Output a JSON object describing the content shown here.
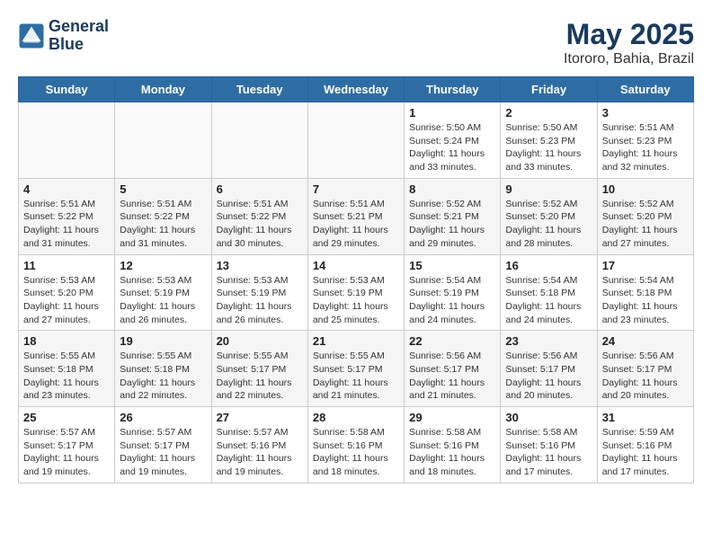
{
  "header": {
    "logo_line1": "General",
    "logo_line2": "Blue",
    "title": "May 2025",
    "subtitle": "Itororo, Bahia, Brazil"
  },
  "days_of_week": [
    "Sunday",
    "Monday",
    "Tuesday",
    "Wednesday",
    "Thursday",
    "Friday",
    "Saturday"
  ],
  "weeks": [
    [
      {
        "day": "",
        "info": ""
      },
      {
        "day": "",
        "info": ""
      },
      {
        "day": "",
        "info": ""
      },
      {
        "day": "",
        "info": ""
      },
      {
        "day": "1",
        "info": "Sunrise: 5:50 AM\nSunset: 5:24 PM\nDaylight: 11 hours and 33 minutes."
      },
      {
        "day": "2",
        "info": "Sunrise: 5:50 AM\nSunset: 5:23 PM\nDaylight: 11 hours and 33 minutes."
      },
      {
        "day": "3",
        "info": "Sunrise: 5:51 AM\nSunset: 5:23 PM\nDaylight: 11 hours and 32 minutes."
      }
    ],
    [
      {
        "day": "4",
        "info": "Sunrise: 5:51 AM\nSunset: 5:22 PM\nDaylight: 11 hours and 31 minutes."
      },
      {
        "day": "5",
        "info": "Sunrise: 5:51 AM\nSunset: 5:22 PM\nDaylight: 11 hours and 31 minutes."
      },
      {
        "day": "6",
        "info": "Sunrise: 5:51 AM\nSunset: 5:22 PM\nDaylight: 11 hours and 30 minutes."
      },
      {
        "day": "7",
        "info": "Sunrise: 5:51 AM\nSunset: 5:21 PM\nDaylight: 11 hours and 29 minutes."
      },
      {
        "day": "8",
        "info": "Sunrise: 5:52 AM\nSunset: 5:21 PM\nDaylight: 11 hours and 29 minutes."
      },
      {
        "day": "9",
        "info": "Sunrise: 5:52 AM\nSunset: 5:20 PM\nDaylight: 11 hours and 28 minutes."
      },
      {
        "day": "10",
        "info": "Sunrise: 5:52 AM\nSunset: 5:20 PM\nDaylight: 11 hours and 27 minutes."
      }
    ],
    [
      {
        "day": "11",
        "info": "Sunrise: 5:53 AM\nSunset: 5:20 PM\nDaylight: 11 hours and 27 minutes."
      },
      {
        "day": "12",
        "info": "Sunrise: 5:53 AM\nSunset: 5:19 PM\nDaylight: 11 hours and 26 minutes."
      },
      {
        "day": "13",
        "info": "Sunrise: 5:53 AM\nSunset: 5:19 PM\nDaylight: 11 hours and 26 minutes."
      },
      {
        "day": "14",
        "info": "Sunrise: 5:53 AM\nSunset: 5:19 PM\nDaylight: 11 hours and 25 minutes."
      },
      {
        "day": "15",
        "info": "Sunrise: 5:54 AM\nSunset: 5:19 PM\nDaylight: 11 hours and 24 minutes."
      },
      {
        "day": "16",
        "info": "Sunrise: 5:54 AM\nSunset: 5:18 PM\nDaylight: 11 hours and 24 minutes."
      },
      {
        "day": "17",
        "info": "Sunrise: 5:54 AM\nSunset: 5:18 PM\nDaylight: 11 hours and 23 minutes."
      }
    ],
    [
      {
        "day": "18",
        "info": "Sunrise: 5:55 AM\nSunset: 5:18 PM\nDaylight: 11 hours and 23 minutes."
      },
      {
        "day": "19",
        "info": "Sunrise: 5:55 AM\nSunset: 5:18 PM\nDaylight: 11 hours and 22 minutes."
      },
      {
        "day": "20",
        "info": "Sunrise: 5:55 AM\nSunset: 5:17 PM\nDaylight: 11 hours and 22 minutes."
      },
      {
        "day": "21",
        "info": "Sunrise: 5:55 AM\nSunset: 5:17 PM\nDaylight: 11 hours and 21 minutes."
      },
      {
        "day": "22",
        "info": "Sunrise: 5:56 AM\nSunset: 5:17 PM\nDaylight: 11 hours and 21 minutes."
      },
      {
        "day": "23",
        "info": "Sunrise: 5:56 AM\nSunset: 5:17 PM\nDaylight: 11 hours and 20 minutes."
      },
      {
        "day": "24",
        "info": "Sunrise: 5:56 AM\nSunset: 5:17 PM\nDaylight: 11 hours and 20 minutes."
      }
    ],
    [
      {
        "day": "25",
        "info": "Sunrise: 5:57 AM\nSunset: 5:17 PM\nDaylight: 11 hours and 19 minutes."
      },
      {
        "day": "26",
        "info": "Sunrise: 5:57 AM\nSunset: 5:17 PM\nDaylight: 11 hours and 19 minutes."
      },
      {
        "day": "27",
        "info": "Sunrise: 5:57 AM\nSunset: 5:16 PM\nDaylight: 11 hours and 19 minutes."
      },
      {
        "day": "28",
        "info": "Sunrise: 5:58 AM\nSunset: 5:16 PM\nDaylight: 11 hours and 18 minutes."
      },
      {
        "day": "29",
        "info": "Sunrise: 5:58 AM\nSunset: 5:16 PM\nDaylight: 11 hours and 18 minutes."
      },
      {
        "day": "30",
        "info": "Sunrise: 5:58 AM\nSunset: 5:16 PM\nDaylight: 11 hours and 17 minutes."
      },
      {
        "day": "31",
        "info": "Sunrise: 5:59 AM\nSunset: 5:16 PM\nDaylight: 11 hours and 17 minutes."
      }
    ]
  ]
}
